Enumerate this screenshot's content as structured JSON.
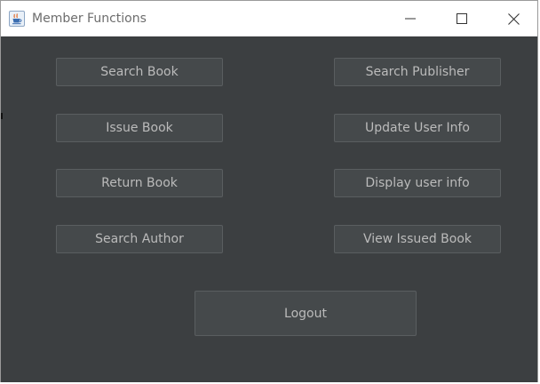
{
  "window": {
    "title": "Member Functions",
    "app_icon": "java-cup-icon"
  },
  "window_controls": {
    "minimize": "minimize-icon",
    "maximize": "maximize-icon",
    "close": "close-icon"
  },
  "buttons": {
    "search_book": "Search Book",
    "search_publisher": "Search Publisher",
    "issue_book": "Issue Book",
    "update_user_info": "Update User Info",
    "return_book": "Return Book",
    "display_user_info": "Display user info",
    "search_author": "Search Author",
    "view_issued_book": "View Issued Book",
    "logout": "Logout"
  },
  "colors": {
    "background": "#3c3f41",
    "button": "#45494b",
    "button_border": "#5a5e60",
    "button_text": "#bbbbbb"
  }
}
